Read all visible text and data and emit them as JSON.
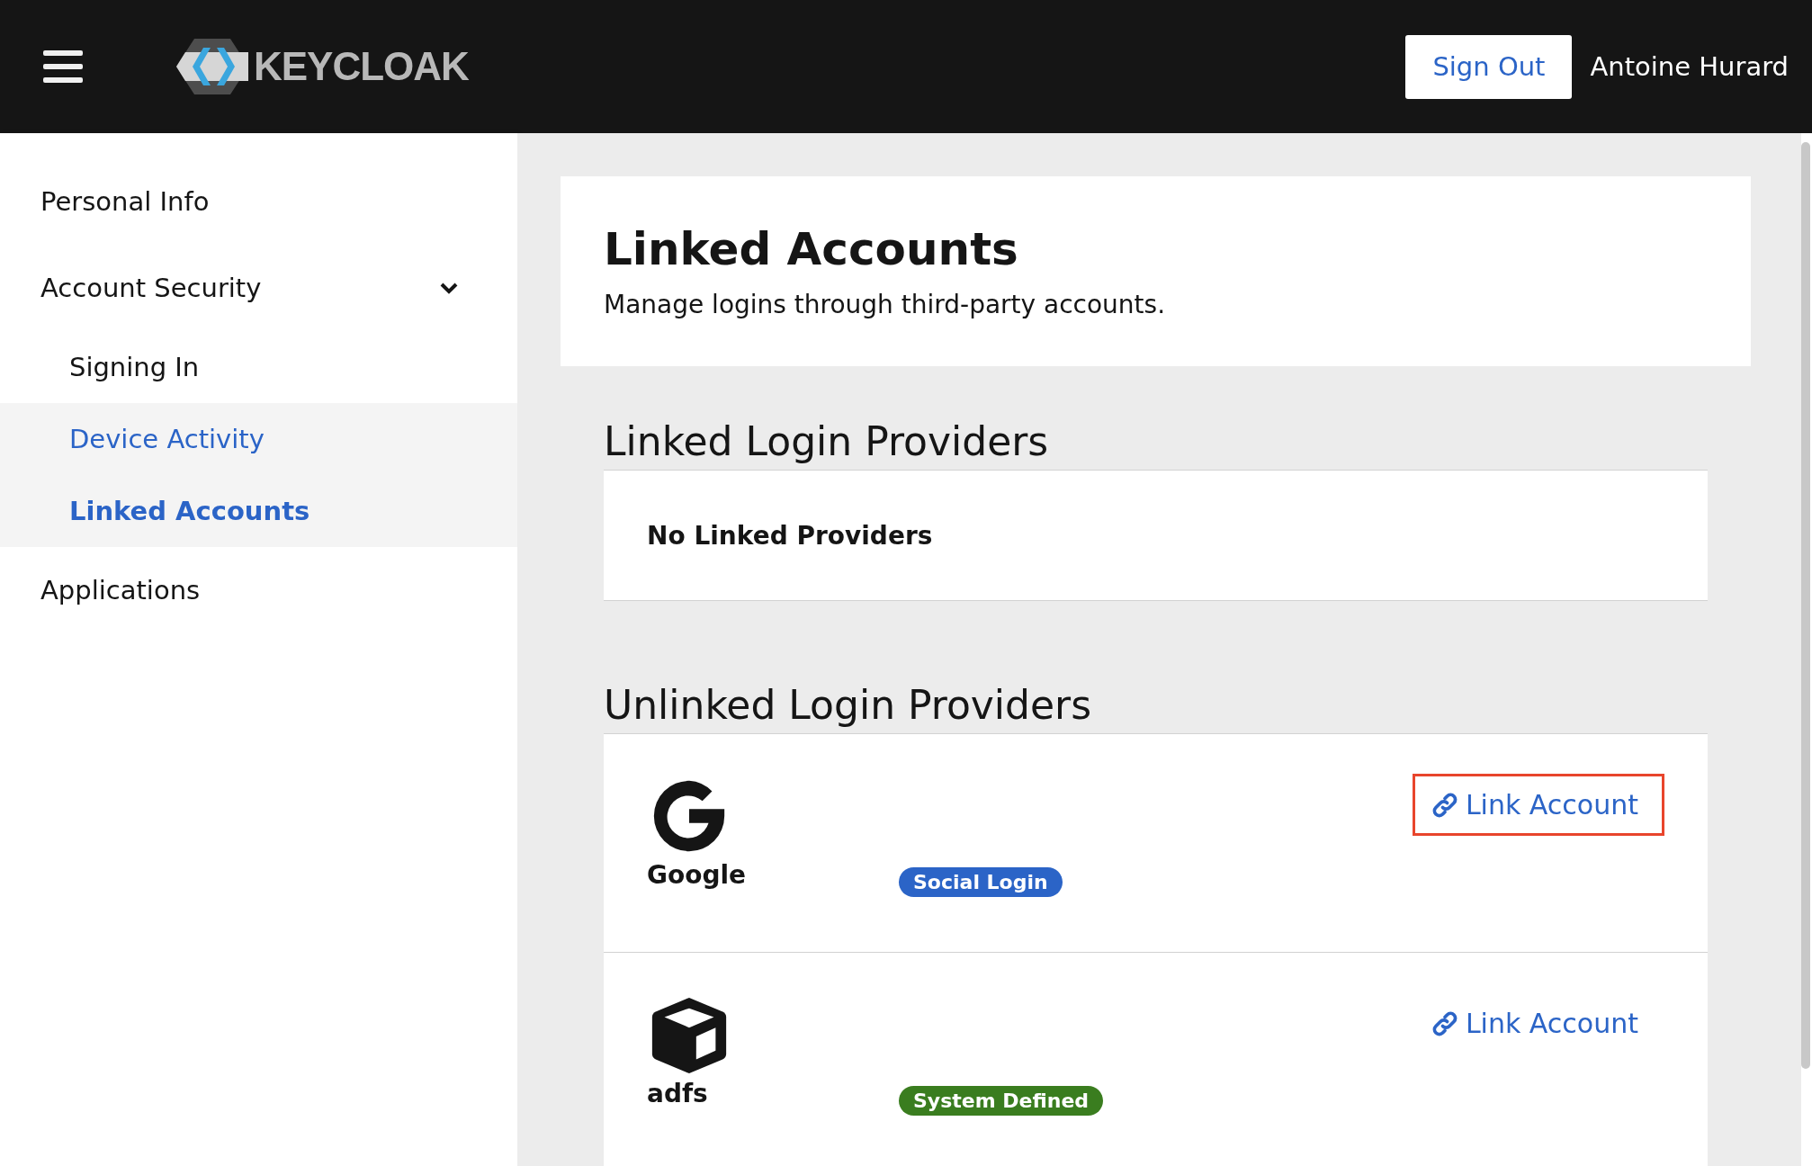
{
  "header": {
    "logo_text": "KEYCLOAK",
    "sign_out": "Sign Out",
    "user_name": "Antoine Hurard"
  },
  "sidebar": {
    "items": [
      {
        "label": "Personal Info",
        "highlighted": false,
        "selected": false
      },
      {
        "label": "Account Security",
        "expanded": true,
        "highlighted": false,
        "selected": false,
        "children": [
          {
            "label": "Signing In",
            "highlighted": false,
            "selected": false
          },
          {
            "label": "Device Activity",
            "highlighted": true,
            "selected": false
          },
          {
            "label": "Linked Accounts",
            "highlighted": true,
            "selected": true
          }
        ]
      },
      {
        "label": "Applications",
        "highlighted": false,
        "selected": false
      }
    ]
  },
  "page": {
    "title": "Linked Accounts",
    "subtitle": "Manage logins through third-party accounts."
  },
  "linked": {
    "heading": "Linked Login Providers",
    "empty_text": "No Linked Providers"
  },
  "unlinked": {
    "heading": "Unlinked Login Providers",
    "providers": [
      {
        "name": "Google",
        "kind": "google",
        "badge": "Social Login",
        "color": "#2b64c7",
        "action": "Link Account",
        "highlighted": true
      },
      {
        "name": "adfs",
        "kind": "box",
        "badge": "System Defined",
        "color": "#3a7d1f",
        "action": "Link Account",
        "highlighted": false
      }
    ]
  }
}
